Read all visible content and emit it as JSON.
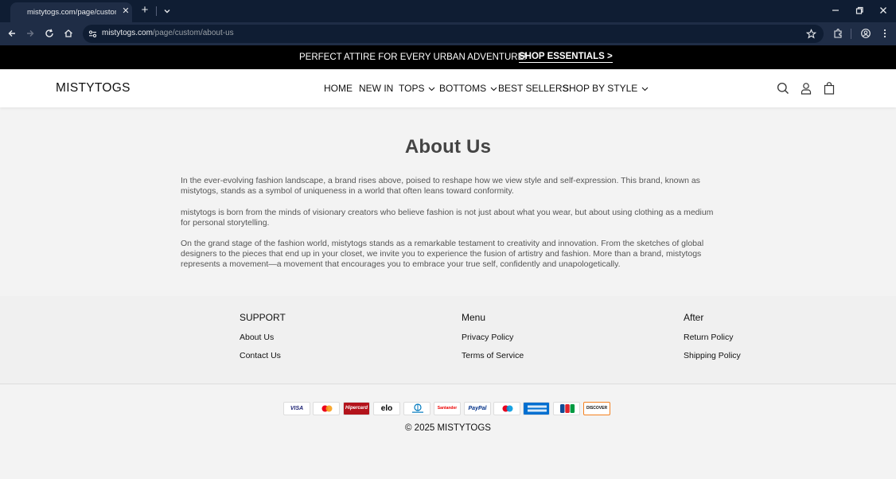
{
  "browser": {
    "tab_title": "mistytogs.com/page/custom/about-us",
    "url_domain": "mistytogs.com",
    "url_path": "/page/custom/about-us"
  },
  "announcement": {
    "text": "PERFECT ATTIRE FOR EVERY URBAN ADVENTURE!",
    "link": "SHOP ESSENTIALS >"
  },
  "header": {
    "logo": "MISTYTOGS",
    "nav": {
      "home": "HOME",
      "new_in": "NEW IN",
      "tops": "TOPS",
      "bottoms": "BOTTOMS",
      "best_sellers": "BEST SELLERS",
      "shop_by_style": "SHOP BY STYLE"
    }
  },
  "page": {
    "title": "About Us",
    "paragraphs": [
      "In the ever-evolving fashion landscape, a brand rises above, poised to reshape how we view style and self-expression. This brand, known as mistytogs, stands as a symbol of uniqueness in a world that often leans toward conformity.",
      "mistytogs is born from the minds of visionary creators who believe fashion is not just about what you wear, but about using clothing as a medium for personal storytelling.",
      "On the grand stage of the fashion world, mistytogs stands as a remarkable testament to creativity and innovation. From the sketches of global designers to the pieces that end up in your closet, we invite you to experience the fusion of artistry and fashion. More than a brand, mistytogs represents a movement—a movement that encourages you to embrace your true self, confidently and unapologetically."
    ]
  },
  "footer": {
    "columns": [
      {
        "heading": "SUPPORT",
        "links": [
          "About Us",
          "Contact Us"
        ]
      },
      {
        "heading": "Menu",
        "links": [
          "Privacy Policy",
          "Terms of Service"
        ]
      },
      {
        "heading": "After",
        "links": [
          "Return Policy",
          "Shipping Policy"
        ]
      }
    ],
    "payment_icons": [
      "visa-icon",
      "mastercard-icon",
      "hipercard-icon",
      "elo-icon",
      "diners-club-icon",
      "santander-icon",
      "paypal-icon",
      "maestro-icon",
      "amex-icon",
      "jcb-icon",
      "discover-icon"
    ],
    "payment_labels": {
      "visa": "VISA",
      "hipercard": "Hipercard",
      "elo": "elo",
      "santander": "Santander",
      "paypal": "PayPal",
      "discover": "DISCOVER"
    },
    "copyright": "© 2025 MISTYTOGS"
  },
  "colors": {
    "chrome_dark": "#0f1d33",
    "chrome_toolbar": "#1f2d46",
    "announcement_bg": "#000000",
    "page_bg": "#f3f3f3"
  }
}
